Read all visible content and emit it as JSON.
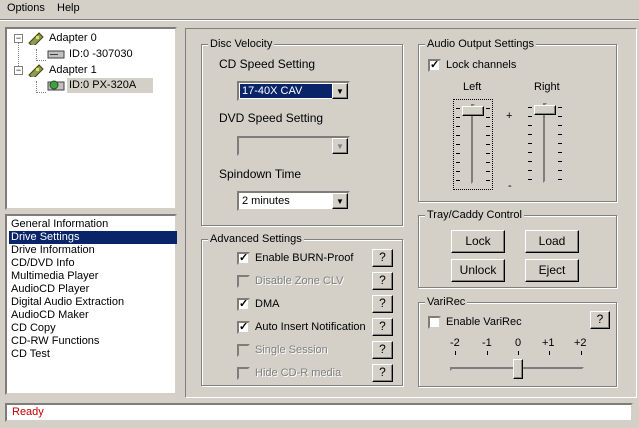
{
  "menu": {
    "options": "Options",
    "help": "Help"
  },
  "tree": {
    "adapter0": "Adapter 0",
    "adapter0_device": "ID:0  -307030",
    "adapter1": "Adapter 1",
    "adapter1_device": "ID:0  PX-320A"
  },
  "nav": {
    "items": [
      "General Information",
      "Drive Settings",
      "Drive Information",
      "CD/DVD Info",
      "Multimedia Player",
      "AudioCD Player",
      "Digital Audio Extraction",
      "AudioCD Maker",
      "CD Copy",
      "CD-RW Functions",
      "CD Test"
    ],
    "selected_index": 1
  },
  "disc_velocity": {
    "title": "Disc Velocity",
    "cd_speed_label": "CD Speed Setting",
    "cd_speed_value": "17-40X CAV",
    "dvd_speed_label": "DVD Speed Setting",
    "dvd_speed_value": "",
    "spindown_label": "Spindown Time",
    "spindown_value": "2 minutes"
  },
  "advanced": {
    "title": "Advanced Settings",
    "options": [
      {
        "label": "Enable BURN-Proof",
        "checked": true,
        "enabled": true
      },
      {
        "label": "Disable Zone CLV",
        "checked": false,
        "enabled": false
      },
      {
        "label": "DMA",
        "checked": true,
        "enabled": true
      },
      {
        "label": "Auto Insert Notification",
        "checked": true,
        "enabled": true
      },
      {
        "label": "Single Session",
        "checked": false,
        "enabled": false
      },
      {
        "label": "Hide CD-R media",
        "checked": false,
        "enabled": false
      }
    ],
    "help_label": "?"
  },
  "audio": {
    "title": "Audio Output Settings",
    "lock_label": "Lock channels",
    "lock_checked": true,
    "left_label": "Left",
    "right_label": "Right",
    "plus": "+",
    "minus": "-",
    "left_level": 1.0,
    "right_level": 1.0
  },
  "tray": {
    "title": "Tray/Caddy Control",
    "lock": "Lock",
    "load": "Load",
    "unlock": "Unlock",
    "eject": "Eject"
  },
  "varirec": {
    "title": "VariRec",
    "enable_label": "Enable VariRec",
    "enable_checked": false,
    "help_label": "?",
    "scale": [
      "-2",
      "-1",
      "0",
      "+1",
      "+2"
    ],
    "value": "0"
  },
  "status": {
    "text": "Ready",
    "color": "#c00000"
  },
  "colors": {
    "selection": "#0a246a",
    "face": "#d4d0c8"
  }
}
